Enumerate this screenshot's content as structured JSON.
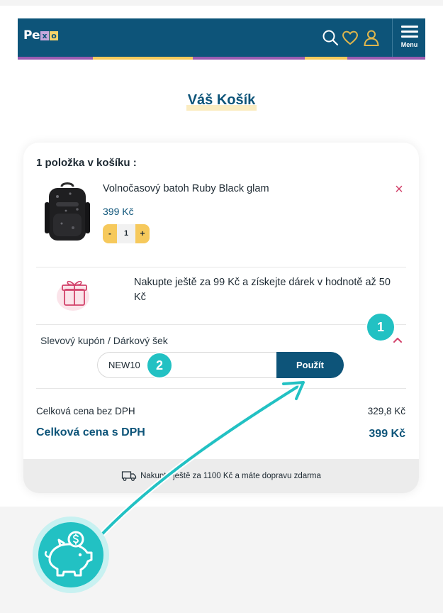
{
  "header": {
    "logo_text": "Pe",
    "logo_letters": [
      "x",
      "o"
    ],
    "menu_label": "Menu",
    "icons": [
      "search-icon",
      "heart-icon",
      "user-icon",
      "hamburger-icon"
    ],
    "stripe_colors": [
      "#9a5cb1",
      "#f6c95c",
      "#9a5cb1",
      "#f6c95c",
      "#9a5cb1"
    ]
  },
  "page_title": "Váš Košík",
  "cart": {
    "count_label": "1 položka v košíku :",
    "items": [
      {
        "name": "Volnočasový batoh Ruby Black glam",
        "price": "399 Kč",
        "quantity": "1",
        "minus_label": "-",
        "plus_label": "+"
      }
    ],
    "remove_label": "×",
    "gift_text": "Nakupte ještě za 99 Kč a získejte dárek v hodnotě až 50 Kč",
    "coupon": {
      "label": "Slevový kupón / Dárkový šek",
      "value": "NEW10",
      "apply_label": "Použít"
    },
    "subtotal_label": "Celková cena bez DPH",
    "subtotal_value": "329,8 Kč",
    "total_label": "Celková cena s DPH",
    "total_value": "399 Kč",
    "shipping_text": "Nakupte ještě za 1100 Kč a máte dopravu zdarma"
  },
  "annotations": {
    "badge1": "1",
    "badge2": "2"
  },
  "colors": {
    "brand": "#0d5479",
    "accent": "#f6c95c",
    "remove": "#d2416a",
    "teal": "#22c1c3"
  }
}
